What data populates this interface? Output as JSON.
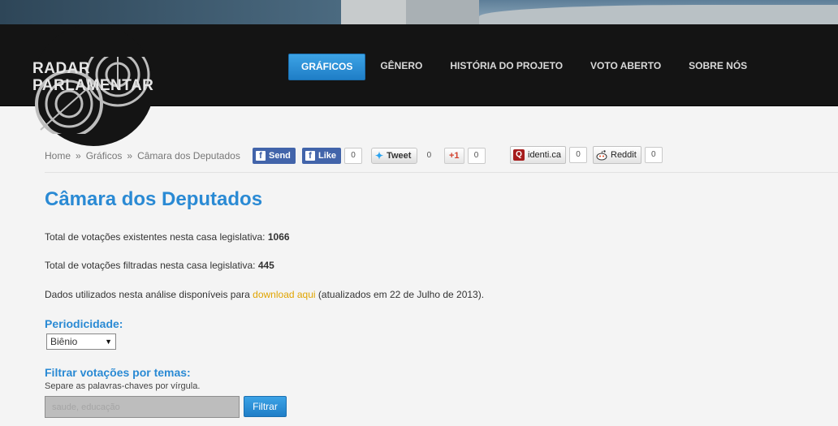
{
  "brand": {
    "line1": "RADAR",
    "line2": "PARLAMENTAR"
  },
  "nav": [
    {
      "label": "GRÁFICOS",
      "active": true
    },
    {
      "label": "GÊNERO"
    },
    {
      "label": "HISTÓRIA DO PROJETO"
    },
    {
      "label": "VOTO ABERTO"
    },
    {
      "label": "SOBRE NÓS"
    }
  ],
  "breadcrumb": {
    "sep": "»",
    "items": [
      "Home",
      "Gráficos",
      "Câmara dos Deputados"
    ]
  },
  "social": {
    "fb_send": "Send",
    "fb_like": "Like",
    "fb_like_count": "0",
    "tweet": "Tweet",
    "tweet_count": "0",
    "gplus": "+1",
    "gplus_count": "0",
    "identica": "identi.ca",
    "identica_count": "0",
    "reddit": "Reddit",
    "reddit_count": "0"
  },
  "page": {
    "title": "Câmara dos Deputados",
    "total_label": "Total de votações existentes nesta casa legislativa:",
    "total_value": "1066",
    "filtered_label": "Total de votações filtradas nesta casa legislativa:",
    "filtered_value": "445",
    "data_prefix": "Dados utilizados nesta análise disponíveis para",
    "data_link": "download aqui",
    "data_suffix": "(atualizados em 22 de Julho de 2013)."
  },
  "periodicity": {
    "label": "Periodicidade:",
    "selected": "Biênio"
  },
  "filter": {
    "label": "Filtrar votações por temas:",
    "hint": "Separe as palavras-chaves por vírgula.",
    "placeholder": "saude, educação",
    "button": "Filtrar"
  },
  "colors": {
    "accent": "#2a8ad4",
    "header_bg": "#141414",
    "link": "#e0a400"
  }
}
